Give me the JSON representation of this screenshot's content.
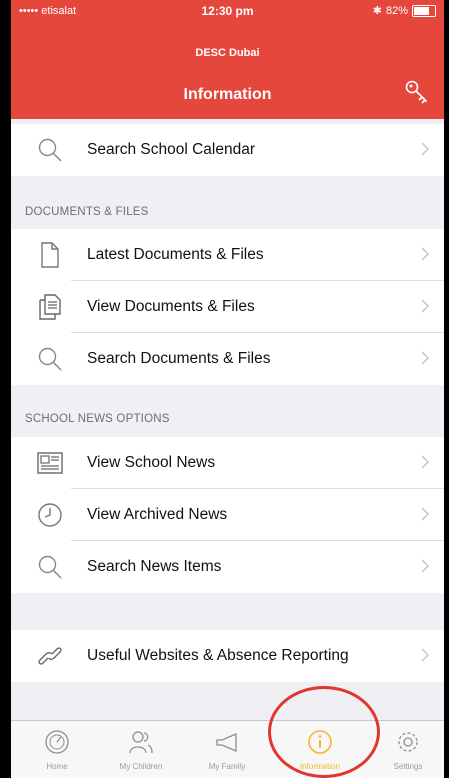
{
  "status_bar": {
    "carrier": "••••• etisalat",
    "time": "12:30 pm",
    "battery": "82%",
    "battery_level": 0.82
  },
  "app": {
    "subtitle": "DESC Dubai",
    "title": "Information"
  },
  "rows": {
    "search_calendar": "Search School Calendar",
    "latest_docs": "Latest Documents & Files",
    "view_docs": "View Documents & Files",
    "search_docs": "Search Documents & Files",
    "view_news": "View School News",
    "archived_news": "View Archived News",
    "search_news": "Search News Items",
    "useful_websites": "Useful Websites & Absence Reporting"
  },
  "sections": {
    "documents": "DOCUMENTS & FILES",
    "news": "SCHOOL NEWS OPTIONS"
  },
  "tabs": [
    {
      "label": "Home",
      "icon": "speedometer-icon"
    },
    {
      "label": "My Children",
      "icon": "people-icon"
    },
    {
      "label": "My Family",
      "icon": "megaphone-icon"
    },
    {
      "label": "Information",
      "icon": "info-icon"
    },
    {
      "label": "Settings",
      "icon": "gear-icon"
    }
  ],
  "colors": {
    "header": "#e5473d",
    "active_tab": "#f4b728",
    "annotation_ring": "#e0372e"
  }
}
